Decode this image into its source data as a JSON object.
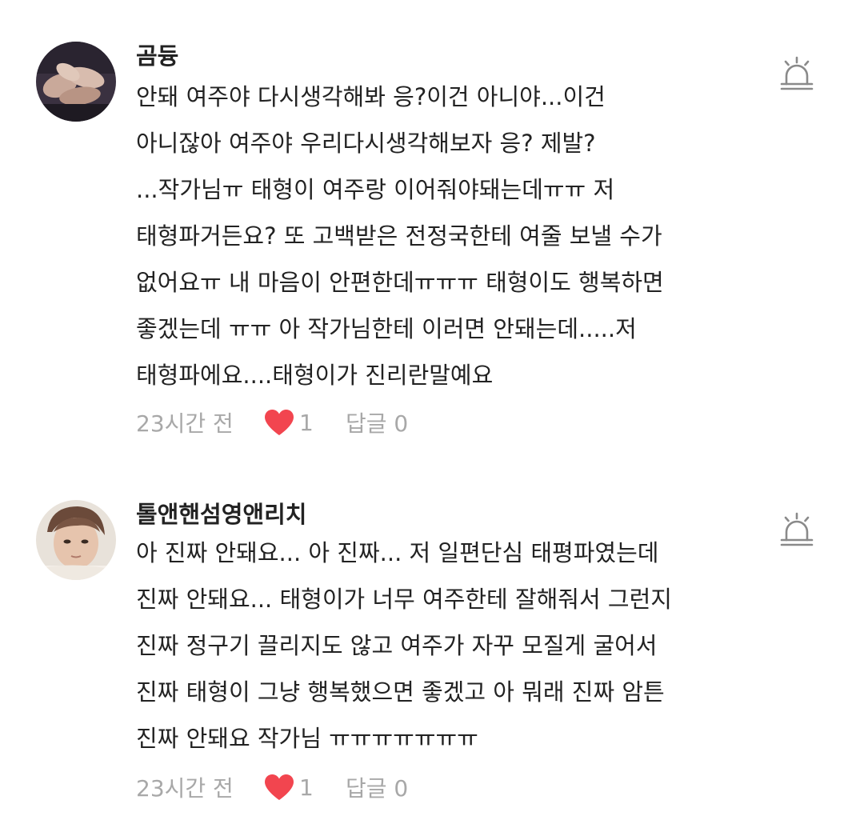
{
  "comments": [
    {
      "username": "곰듕",
      "lines": [
        "안돼 여주야 다시생각해봐 응?이건 아니야...이건",
        "아니잖아 여주야 우리다시생각해보자 응? 제발?",
        "...작가님ㅠ 태형이 여주랑 이어줘야돼는데ㅠㅠ 저",
        "태형파거든요? 또 고백받은 전정국한테 여줄 보낼 수가",
        "없어요ㅠ 내 마음이 안편한데ㅠㅠㅠ 태형이도 행복하면",
        "좋겠는데 ㅠㅠ 아 작가님한테 이러면 안돼는데.....저",
        "태형파에요....태형이가 진리란말예요"
      ],
      "time": "23시간 전",
      "likes": "1",
      "reply": "답글 0"
    },
    {
      "username": "톨앤핸섬영앤리치",
      "lines": [
        "아 진짜 안돼요... 아 진짜... 저 일편단심 태평파였는데",
        "진짜 안돼요... 태형이가 너무 여주한테 잘해줘서 그런지",
        "진짜 정구기 끌리지도 않고 여주가 자꾸 모질게 굴어서",
        "진짜 태형이 그냥 행복했으면 좋겠고 아 뭐래 진짜 암튼",
        "진짜 안돼요 작가님 ㅠㅠㅠㅠㅠㅠㅠ"
      ],
      "time": "23시간 전",
      "likes": "1",
      "reply": "답글 0"
    }
  ],
  "icons": {
    "report": "siren-report-icon",
    "like": "heart-icon"
  },
  "colors": {
    "text": "#222222",
    "meta": "#a8a8a8",
    "heart": "#f2454f",
    "icon": "#8a8a8a"
  }
}
